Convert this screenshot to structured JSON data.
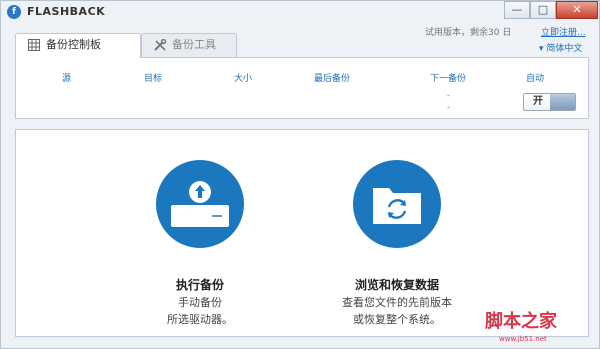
{
  "window": {
    "title": "FLASHBACK",
    "app_icon_glyph": "f",
    "buttons": {
      "minimize": "—",
      "maximize": "□",
      "close": "✕"
    }
  },
  "header": {
    "trial_text": "试用版本，剩余30 日",
    "register_link": "立即注册...",
    "language": "▾ 简体中文"
  },
  "tabs": [
    {
      "label": "备份控制板",
      "icon": "grid-icon",
      "active": true
    },
    {
      "label": "备份工具",
      "icon": "tools-icon",
      "active": false
    }
  ],
  "backup_table": {
    "columns": [
      "源",
      "目标",
      "大小",
      "最后备份",
      "下一备份",
      "自动"
    ],
    "next_backup_values": [
      "-",
      "-"
    ],
    "auto_toggle": {
      "label": "开",
      "state": "on"
    }
  },
  "actions": [
    {
      "title_prefix": "执行",
      "title_bold": "备份",
      "lines": [
        "手动备份",
        "所选驱动器。"
      ],
      "icon": "drive-upload-icon"
    },
    {
      "title_prefix": "浏览和",
      "title_bold": "恢复",
      "title_suffix": "数据",
      "lines": [
        "查看您文件的先前版本",
        "或恢复整个系统。"
      ],
      "icon": "folder-restore-icon"
    }
  ],
  "watermark": {
    "logo": "脚本之家",
    "url": "www.jb51.net"
  },
  "colors": {
    "accent": "#1b78be",
    "link": "#1f6fbd"
  }
}
